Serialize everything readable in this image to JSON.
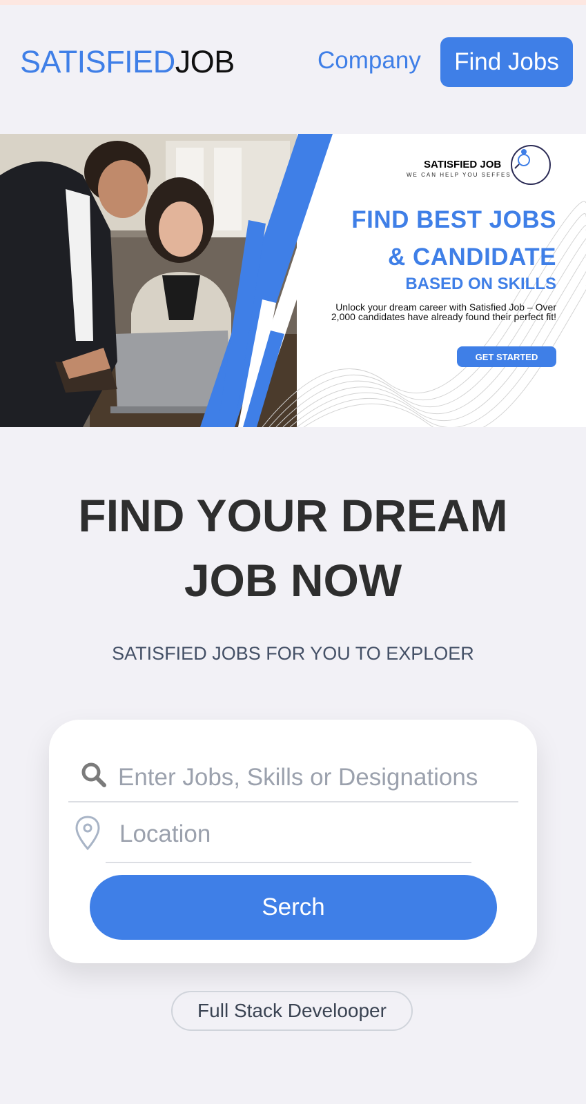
{
  "header": {
    "logo_part1": "SATISFIED",
    "logo_part2": "JOB",
    "nav_company": "Company",
    "nav_find_jobs": "Find Jobs"
  },
  "banner": {
    "brand": "SATISFIED JOB",
    "tagline": "WE CAN HELP YOU SEFFES",
    "logo_text": "SATISFIEDJOB",
    "headline_line1": "FIND BEST JOBS",
    "headline_line2": "& CANDIDATE",
    "headline_line3": "BASED ON SKILLS",
    "description": "Unlock  your dream career with Satisfied Job – Over 2,000 candidates have already found their perfect fit!",
    "cta": "GET STARTED"
  },
  "hero": {
    "title_line1": "FIND YOUR DREAM",
    "title_line2": "JOB NOW",
    "subtitle": "SATISFIED JOBS FOR YOU TO EXPLOER"
  },
  "search": {
    "keyword_placeholder": "Enter Jobs, Skills or Designations",
    "keyword_value": "",
    "location_placeholder": "Location",
    "location_value": "",
    "button_label": "Serch",
    "keyword_icon": "search-icon",
    "location_icon": "location-pin-icon"
  },
  "suggestions": [
    "Full Stack Develooper"
  ],
  "colors": {
    "accent": "#3f7fe7",
    "background": "#f2f1f6",
    "heading": "#2e2e2e",
    "subtext": "#445066"
  }
}
